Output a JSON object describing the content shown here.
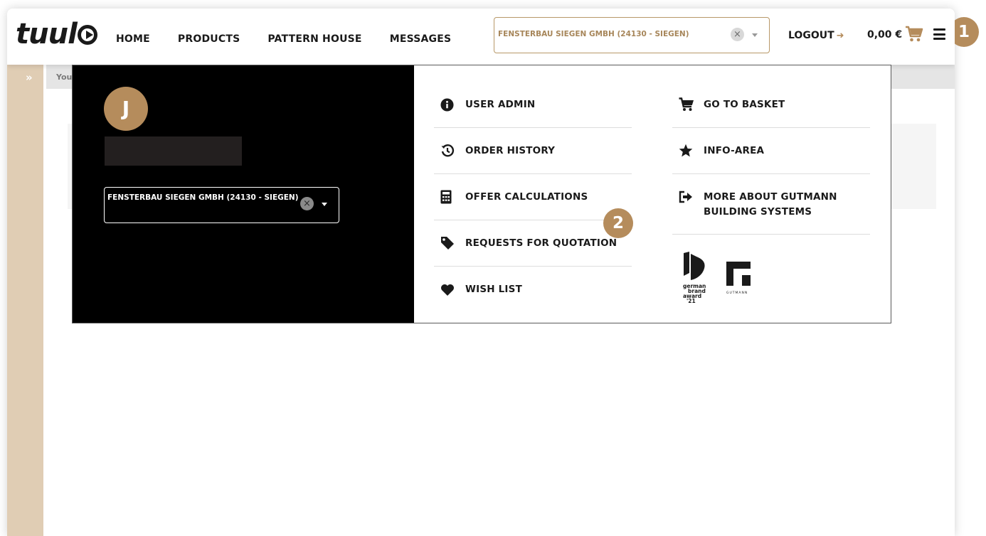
{
  "brand": {
    "logo_text": "tuul"
  },
  "nav": {
    "items": [
      "HOME",
      "PRODUCTS",
      "PATTERN HOUSE",
      "MESSAGES"
    ]
  },
  "company_select": {
    "value": "FENSTERBAU SIEGEN GMBH (24130 - SIEGEN)",
    "clear_icon": "×"
  },
  "header": {
    "logout_label": "LOGOUT",
    "logout_icon": "➜",
    "cart_total": "0,00 €"
  },
  "badges": {
    "one": "1",
    "two": "2"
  },
  "sidebar": {
    "toggle_icon": "»"
  },
  "breadcrumb": {
    "text": "You"
  },
  "mega_menu": {
    "avatar_initial": "J",
    "company_select": {
      "value": "FENSTERBAU SIEGEN GMBH (24130 - SIEGEN)",
      "clear_icon": "×"
    },
    "col1": [
      {
        "icon": "info-icon",
        "label": "USER ADMIN"
      },
      {
        "icon": "history-icon",
        "label": "ORDER HISTORY"
      },
      {
        "icon": "calculator-icon",
        "label": "OFFER CALCULATIONS"
      },
      {
        "icon": "tag-icon",
        "label": "REQUESTS FOR QUOTATION"
      },
      {
        "icon": "heart-icon",
        "label": "WISH LIST"
      }
    ],
    "col2": [
      {
        "icon": "cart-icon",
        "label": "GO TO BASKET"
      },
      {
        "icon": "star-icon",
        "label": "INFO-AREA"
      },
      {
        "icon": "sign-out-icon",
        "label": "MORE ABOUT GUTMANN\nBUILDING SYSTEMS"
      }
    ],
    "award_text": "german brand award '21",
    "award_lines": [
      "german",
      "brand",
      "award",
      "'21"
    ],
    "gutmann_text": "GUTMANN"
  },
  "colors": {
    "accent": "#b58c5c",
    "accent_text": "#a7865a",
    "sidebar": "#e0cdb4"
  }
}
